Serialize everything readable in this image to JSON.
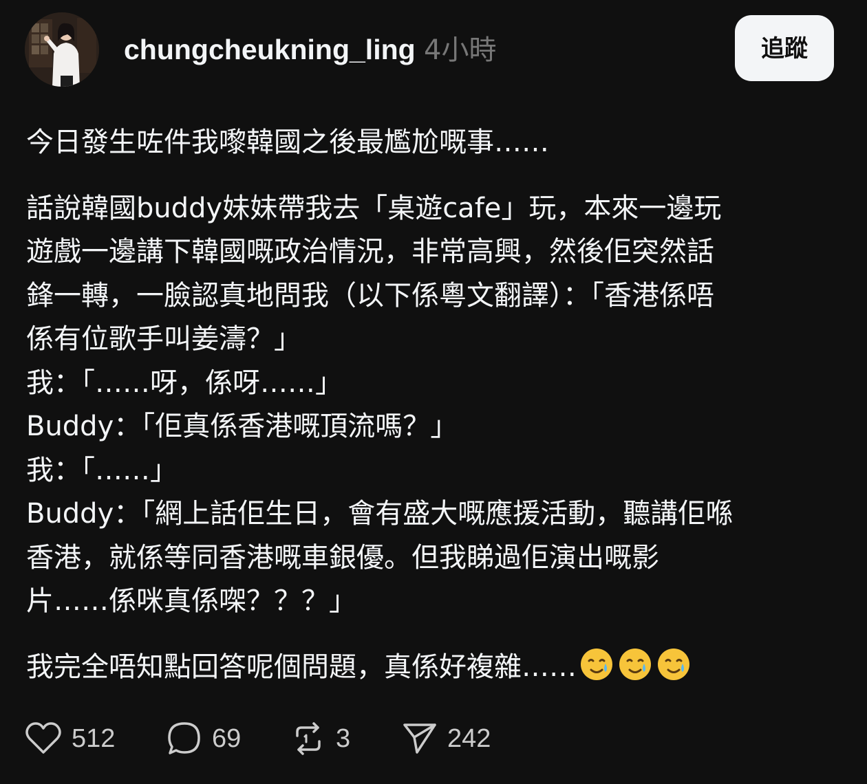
{
  "header": {
    "username": "chungcheukning_ling",
    "timestamp": "4小時",
    "follow_label": "追蹤",
    "avatar_icon": "profile-photo-icon"
  },
  "post": {
    "paragraphs": [
      {
        "lines": [
          "今日發生咗件我嚟韓國之後最尷尬嘅事……"
        ]
      },
      {
        "lines": [
          "話說韓國buddy妹妹帶我去「桌遊cafe」玩，本來一邊玩",
          "遊戲一邊講下韓國嘅政治情況，非常高興，然後佢突然話",
          "鋒一轉，一臉認真地問我（以下係粵文翻譯）：「香港係唔",
          "係有位歌手叫姜濤？」",
          "我：「……呀，係呀……」",
          "Buddy：「佢真係香港嘅頂流嗎？」",
          "我：「……」",
          "Buddy：「網上話佢生日，會有盛大嘅應援活動，聽講佢喺",
          "香港，就係等同香港嘅車銀優。但我睇過佢演出嘅影",
          "片……係咪真係㗎？？？」"
        ]
      },
      {
        "lines": [
          "我完全唔知點回答呢個問題，真係好複雜……"
        ],
        "emojis": [
          "smiling-face-with-tear-icon",
          "smiling-face-with-tear-icon",
          "smiling-face-with-tear-icon"
        ]
      }
    ]
  },
  "actions": {
    "like": {
      "icon": "heart-icon",
      "count": "512"
    },
    "comment": {
      "icon": "comment-bubble-icon",
      "count": "69"
    },
    "repost": {
      "icon": "repost-icon",
      "count": "3"
    },
    "share": {
      "icon": "send-icon",
      "count": "242"
    }
  },
  "colors": {
    "background": "#101010",
    "text": "#f3f5f7",
    "muted": "#777777",
    "button_bg": "#f3f5f7"
  }
}
